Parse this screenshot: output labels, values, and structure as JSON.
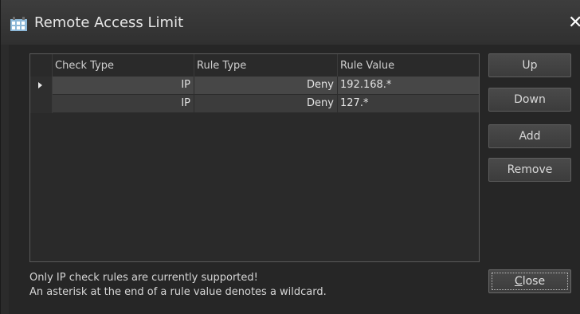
{
  "window": {
    "title": "Remote Access Limit",
    "close_glyph": "✕"
  },
  "grid": {
    "columns": [
      "Check Type",
      "Rule Type",
      "Rule Value"
    ],
    "rows": [
      {
        "check_type": "IP",
        "rule_type": "Deny",
        "rule_value": "192.168.*",
        "selected": true
      },
      {
        "check_type": "IP",
        "rule_type": "Deny",
        "rule_value": "127.*",
        "selected": false
      }
    ]
  },
  "buttons": {
    "up": "Up",
    "down": "Down",
    "add": "Add",
    "remove": "Remove",
    "close_first": "C",
    "close_rest": "lose"
  },
  "notes": {
    "line1": "Only IP check rules are currently supported!",
    "line2": "An asterisk at the end of a rule value denotes a wildcard."
  },
  "icons": {
    "window": "app-window-icon",
    "row_indicator": "row-pointer-icon"
  }
}
